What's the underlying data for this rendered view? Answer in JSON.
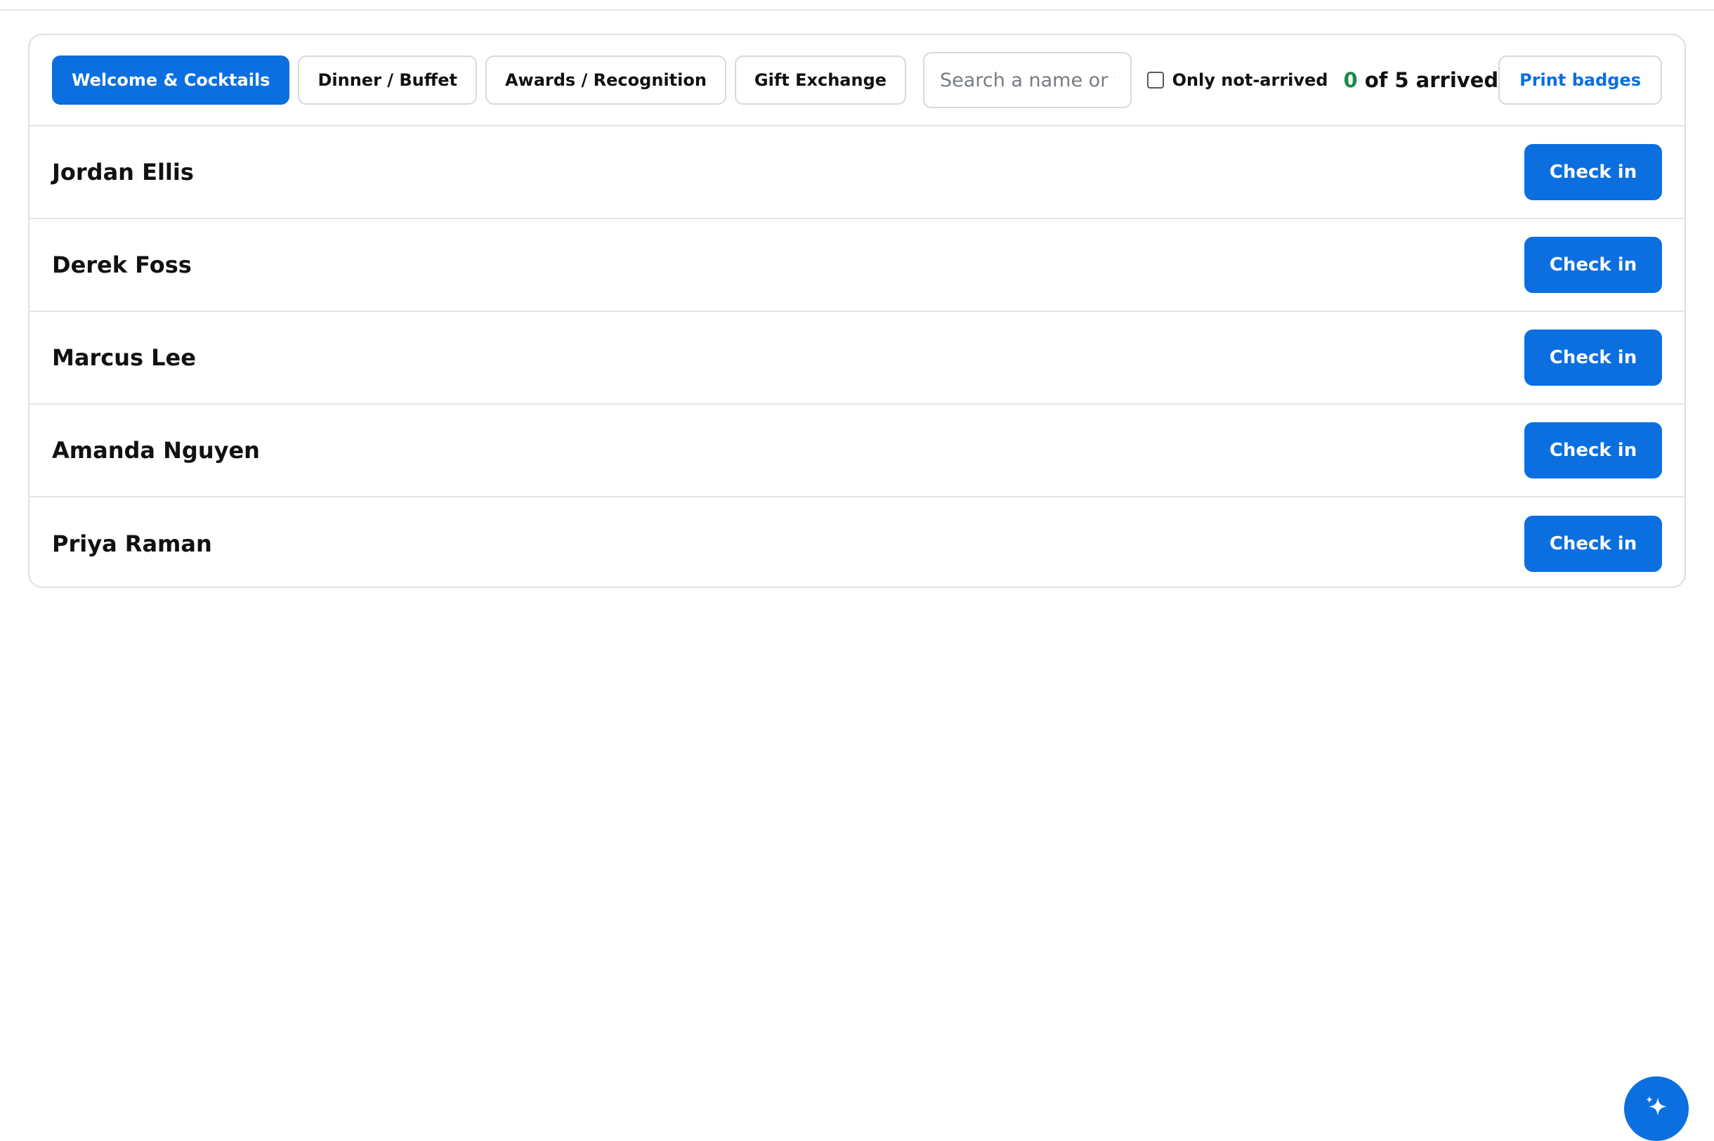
{
  "tabs": [
    {
      "label": "Welcome & Cocktails",
      "active": true
    },
    {
      "label": "Dinner / Buffet",
      "active": false
    },
    {
      "label": "Awards / Recognition",
      "active": false
    },
    {
      "label": "Gift Exchange",
      "active": false
    }
  ],
  "search": {
    "placeholder": "Search a name or table…",
    "value": ""
  },
  "filter": {
    "label": "Only not-arrived",
    "checked": false
  },
  "summary": {
    "arrived_count": "0",
    "rest": " of 5 arrived"
  },
  "print_badges_label": "Print badges",
  "guests": [
    {
      "name": "Jordan Ellis",
      "action": "Check in"
    },
    {
      "name": "Derek Foss",
      "action": "Check in"
    },
    {
      "name": "Marcus Lee",
      "action": "Check in"
    },
    {
      "name": "Amanda Nguyen",
      "action": "Check in"
    },
    {
      "name": "Priya Raman",
      "action": "Check in"
    }
  ],
  "fab_icon": "sparkle-icon",
  "colors": {
    "accent": "#0b6fe0",
    "arrived_count": "#1c8a4a"
  }
}
